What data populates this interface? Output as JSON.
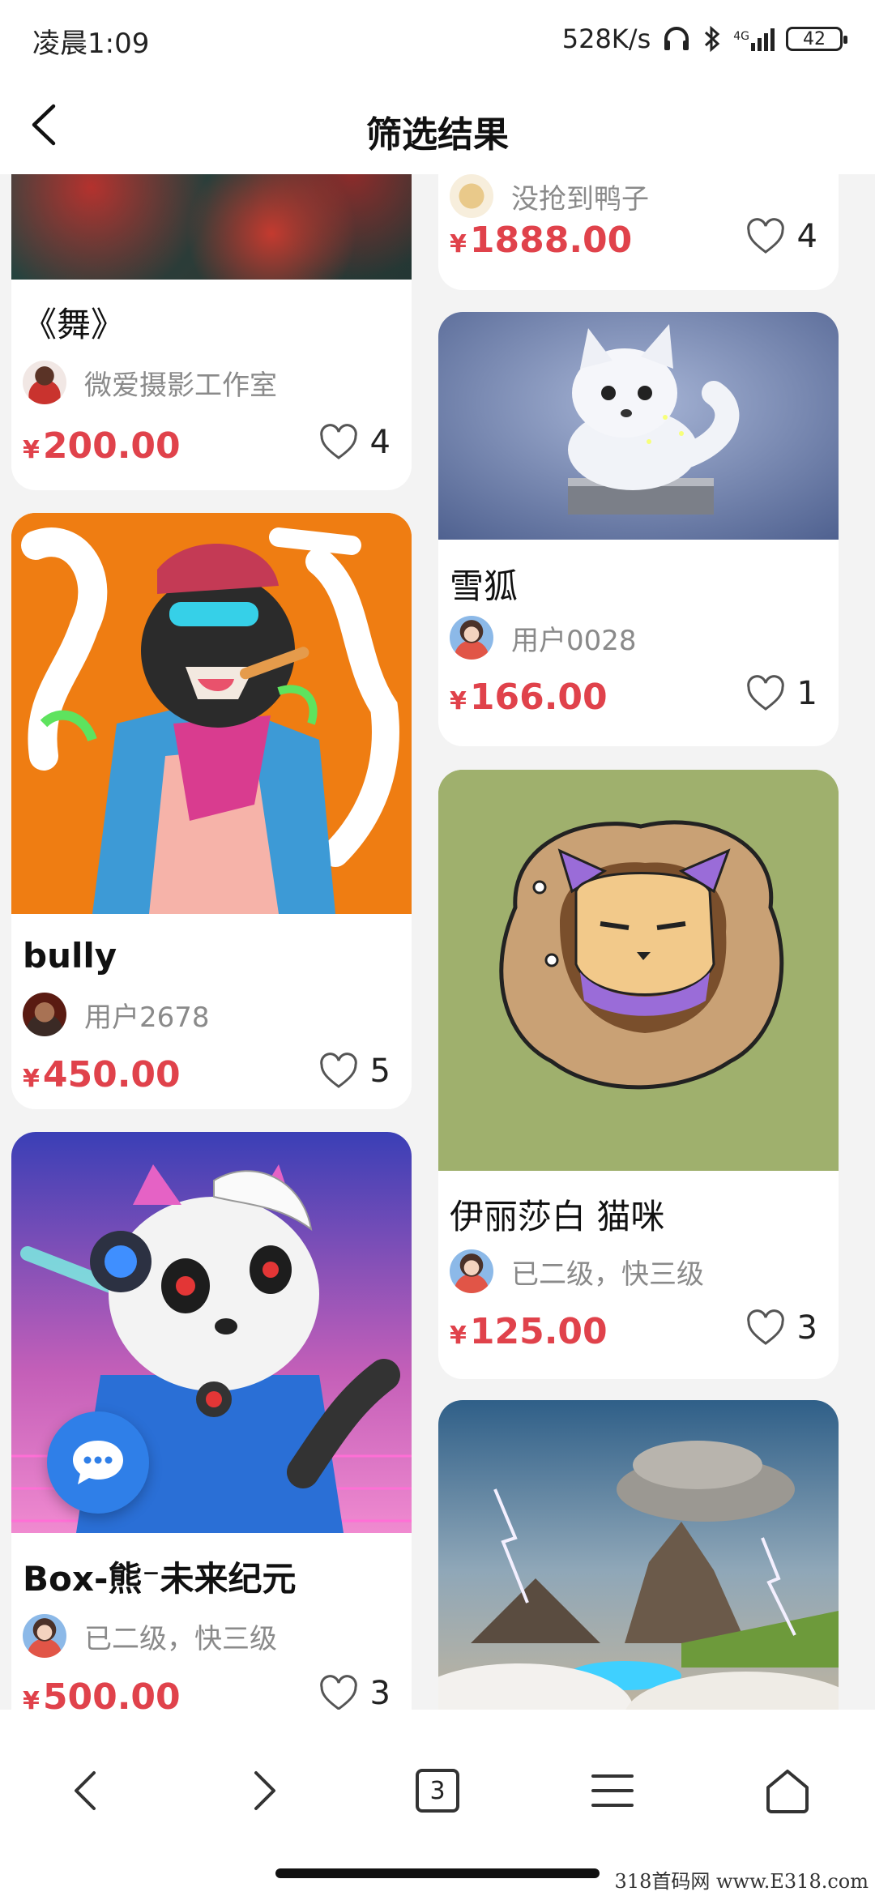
{
  "status_bar": {
    "time": "凌晨1:09",
    "net_speed": "528K/s",
    "network_type": "4G",
    "battery": "42",
    "icons": [
      "headphones-icon",
      "bluetooth-icon",
      "signal-icon",
      "battery-icon"
    ]
  },
  "header": {
    "title": "筛选结果",
    "back_icon": "chevron-left-icon"
  },
  "cards": [
    {
      "title": "《舞》",
      "user": "微爱摄影工作室",
      "price": "200.00",
      "likes": "4"
    },
    {
      "title": "bully",
      "user": "用户2678",
      "price": "450.00",
      "likes": "5"
    },
    {
      "title": "Box-熊⁻未来纪元",
      "user": "已二级，快三级",
      "price": "500.00",
      "likes": "3"
    },
    {
      "title": "",
      "user": "没抢到鸭子",
      "price": "1888.00",
      "likes": "4"
    },
    {
      "title": "雪狐",
      "user": "用户0028",
      "price": "166.00",
      "likes": "1"
    },
    {
      "title": "伊丽莎白 猫咪",
      "user": "已二级，快三级",
      "price": "125.00",
      "likes": "3"
    },
    {
      "title": "",
      "user": "",
      "price": "",
      "likes": ""
    }
  ],
  "currency": "¥",
  "bottom_nav": {
    "tab_count": "3",
    "icons": [
      "back-arrow-icon",
      "forward-arrow-icon",
      "tabs-icon",
      "menu-icon",
      "home-icon"
    ]
  },
  "watermark": "318首码网 www.E318.com",
  "colors": {
    "price": "#e0424b",
    "background": "#f3f3f3",
    "chat_fab": "#2f7fe8"
  }
}
